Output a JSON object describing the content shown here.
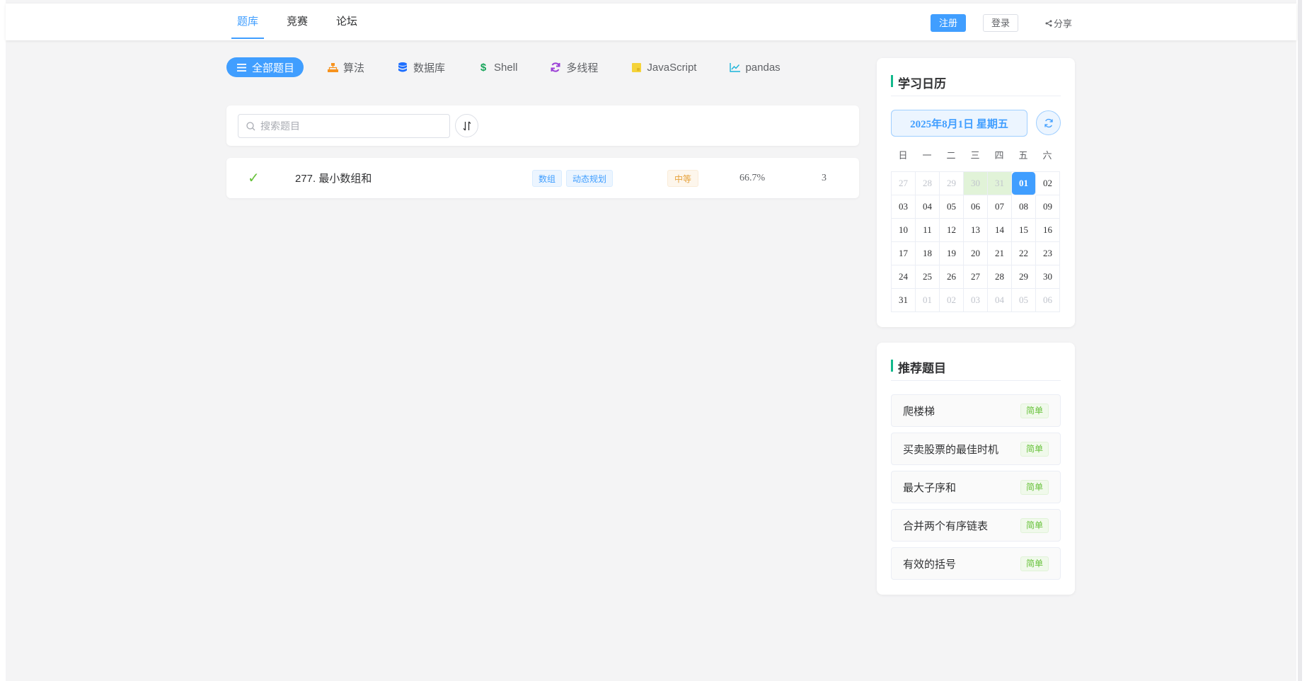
{
  "nav": {
    "tabs": [
      {
        "label": "题库",
        "active": true
      },
      {
        "label": "竞赛",
        "active": false
      },
      {
        "label": "论坛",
        "active": false
      }
    ],
    "register_label": "注册",
    "login_label": "登录",
    "share_label": "分享"
  },
  "categories": [
    {
      "label": "全部题目",
      "icon": "list-icon",
      "active": true
    },
    {
      "label": "算法",
      "icon": "sitemap-icon",
      "color": "#f7931e"
    },
    {
      "label": "数据库",
      "icon": "database-icon",
      "color": "#1e6fff"
    },
    {
      "label": "Shell",
      "icon": "dollar-icon",
      "color": "#19a55b"
    },
    {
      "label": "多线程",
      "icon": "sync-icon",
      "color": "#9b3fd6"
    },
    {
      "label": "JavaScript",
      "icon": "js-icon",
      "color": "#f5d33a"
    },
    {
      "label": "pandas",
      "icon": "chart-line-icon",
      "color": "#1ab3d9"
    }
  ],
  "search": {
    "placeholder": "搜索题目"
  },
  "problems": [
    {
      "solved": true,
      "title": "277. 最小数组和",
      "tags": [
        "数组",
        "动态规划"
      ],
      "difficulty": "中等",
      "pass_rate": "66.7%",
      "count": "3"
    }
  ],
  "calendar": {
    "title": "学习日历",
    "date_label": "2025年8月1日 星期五",
    "weekdays": [
      "日",
      "一",
      "二",
      "三",
      "四",
      "五",
      "六"
    ],
    "days": [
      {
        "d": "27",
        "type": "other"
      },
      {
        "d": "28",
        "type": "other"
      },
      {
        "d": "29",
        "type": "other"
      },
      {
        "d": "30",
        "type": "done"
      },
      {
        "d": "31",
        "type": "done"
      },
      {
        "d": "01",
        "type": "today"
      },
      {
        "d": "02",
        "type": ""
      },
      {
        "d": "03",
        "type": ""
      },
      {
        "d": "04",
        "type": ""
      },
      {
        "d": "05",
        "type": ""
      },
      {
        "d": "06",
        "type": ""
      },
      {
        "d": "07",
        "type": ""
      },
      {
        "d": "08",
        "type": ""
      },
      {
        "d": "09",
        "type": ""
      },
      {
        "d": "10",
        "type": ""
      },
      {
        "d": "11",
        "type": ""
      },
      {
        "d": "12",
        "type": ""
      },
      {
        "d": "13",
        "type": ""
      },
      {
        "d": "14",
        "type": ""
      },
      {
        "d": "15",
        "type": ""
      },
      {
        "d": "16",
        "type": ""
      },
      {
        "d": "17",
        "type": ""
      },
      {
        "d": "18",
        "type": ""
      },
      {
        "d": "19",
        "type": ""
      },
      {
        "d": "20",
        "type": ""
      },
      {
        "d": "21",
        "type": ""
      },
      {
        "d": "22",
        "type": ""
      },
      {
        "d": "23",
        "type": ""
      },
      {
        "d": "24",
        "type": ""
      },
      {
        "d": "25",
        "type": ""
      },
      {
        "d": "26",
        "type": ""
      },
      {
        "d": "27",
        "type": ""
      },
      {
        "d": "28",
        "type": ""
      },
      {
        "d": "29",
        "type": ""
      },
      {
        "d": "30",
        "type": ""
      },
      {
        "d": "31",
        "type": ""
      },
      {
        "d": "01",
        "type": "other"
      },
      {
        "d": "02",
        "type": "other"
      },
      {
        "d": "03",
        "type": "other"
      },
      {
        "d": "04",
        "type": "other"
      },
      {
        "d": "05",
        "type": "other"
      },
      {
        "d": "06",
        "type": "other"
      }
    ]
  },
  "recommend": {
    "title": "推荐题目",
    "items": [
      {
        "title": "爬楼梯",
        "difficulty": "简单"
      },
      {
        "title": "买卖股票的最佳时机",
        "difficulty": "简单"
      },
      {
        "title": "最大子序和",
        "difficulty": "简单"
      },
      {
        "title": "合并两个有序链表",
        "difficulty": "简单"
      },
      {
        "title": "有效的括号",
        "difficulty": "简单"
      }
    ]
  },
  "colors": {
    "accent": "#409eff",
    "success": "#67c23a",
    "warning": "#e6a23c",
    "title_bar": "#13b98c"
  }
}
